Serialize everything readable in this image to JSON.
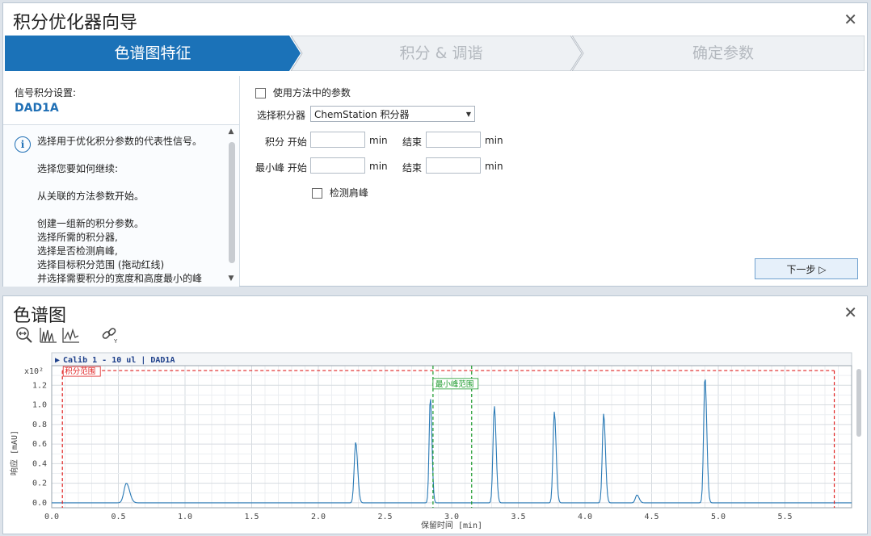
{
  "wizard": {
    "title": "积分优化器向导",
    "steps": [
      {
        "label": "色谱图特征",
        "active": true
      },
      {
        "label": "积分 & 调谐",
        "active": false
      },
      {
        "label": "确定参数",
        "active": false
      }
    ],
    "signal_label": "信号积分设置:",
    "signal_value": "DAD1A",
    "info_lines": [
      "选择用于优化积分参数的代表性信号。",
      "选择您要如何继续:",
      "从关联的方法参数开始。",
      "创建一组新的积分参数。\n选择所需的积分器,\n选择是否检测肩峰,\n选择目标积分范围 (拖动红线)\n并选择需要积分的宽度和高度最小的峰"
    ],
    "use_method_params": "使用方法中的参数",
    "select_integrator_label": "选择积分器",
    "integrator_value": "ChemStation 积分器",
    "integration_start_label": "积分 开始",
    "min_peak_start_label": "最小峰 开始",
    "end_label": "结束",
    "unit": "min",
    "detect_shoulders": "检测肩峰",
    "next_button": "下一步"
  },
  "chromatogram": {
    "title": "色谱图",
    "tools": [
      "zoom-icon",
      "peaks-icon",
      "baseline-icon",
      "link-icon"
    ]
  },
  "colors": {
    "accent": "#1d6fb4",
    "trace": "#2a7ab6",
    "integration_range": "#e02020",
    "min_peak_range": "#1a9a2a"
  },
  "chart_data": {
    "type": "line",
    "header": "Calib 1 - 10 ul | DAD1A",
    "x_unit_label": "x10²",
    "xlabel": "保留时间 [min]",
    "ylabel": "响应 [mAU]",
    "xlim": [
      0,
      6.0
    ],
    "ylim": [
      -0.05,
      1.4
    ],
    "x_ticks": [
      0.0,
      0.5,
      1.0,
      1.5,
      2.0,
      2.5,
      3.0,
      3.5,
      4.0,
      4.5,
      5.0,
      5.5
    ],
    "y_ticks": [
      0.0,
      0.2,
      0.4,
      0.6,
      0.8,
      1.0,
      1.2
    ],
    "grid": true,
    "integration_range": {
      "label": "积分范围",
      "x": [
        0.08,
        5.87
      ],
      "y": 1.35
    },
    "min_peak_range": {
      "label": "最小峰范围",
      "x": [
        2.86,
        3.15
      ]
    },
    "baseline": 0.0,
    "peaks": [
      {
        "rt": 0.56,
        "height": 0.2,
        "width": 0.018
      },
      {
        "rt": 2.28,
        "height": 0.62,
        "width": 0.011
      },
      {
        "rt": 2.84,
        "height": 1.08,
        "width": 0.009
      },
      {
        "rt": 3.32,
        "height": 0.99,
        "width": 0.01
      },
      {
        "rt": 3.77,
        "height": 0.93,
        "width": 0.01
      },
      {
        "rt": 4.14,
        "height": 0.91,
        "width": 0.01
      },
      {
        "rt": 4.39,
        "height": 0.08,
        "width": 0.012
      },
      {
        "rt": 4.9,
        "height": 1.29,
        "width": 0.01
      }
    ]
  }
}
